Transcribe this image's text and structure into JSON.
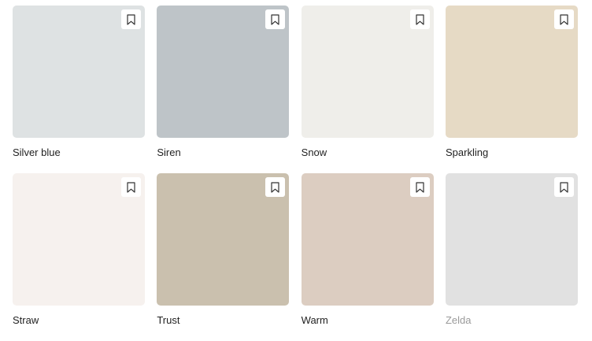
{
  "colors": [
    {
      "name": "Silver blue",
      "hex": "#dee2e3"
    },
    {
      "name": "Siren",
      "hex": "#bec4c8"
    },
    {
      "name": "Snow",
      "hex": "#efeeea"
    },
    {
      "name": "Sparkling",
      "hex": "#e6dac5"
    },
    {
      "name": "Straw",
      "hex": "#f6f1ee"
    },
    {
      "name": "Trust",
      "hex": "#cac0ae"
    },
    {
      "name": "Warm",
      "hex": "#dccdc1"
    },
    {
      "name": "Zelda",
      "hex": "#e1e1e1"
    }
  ],
  "icons": {
    "bookmark": "bookmark-icon"
  }
}
